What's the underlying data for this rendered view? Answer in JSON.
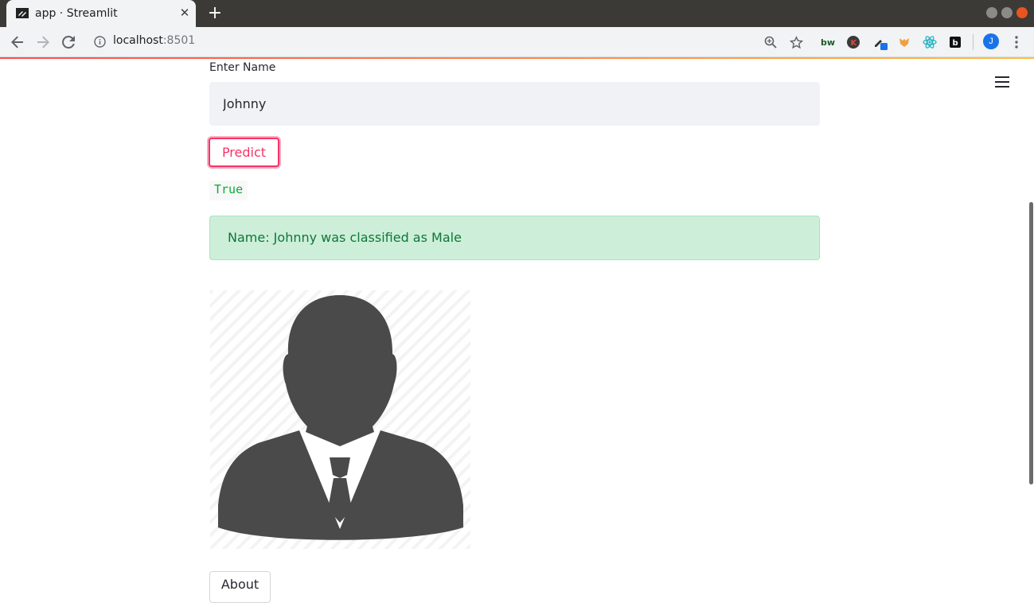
{
  "browser": {
    "tab_title": "app · Streamlit",
    "url_host": "localhost",
    "url_port": ":8501",
    "profile_initial": "J"
  },
  "form": {
    "label": "Enter Name",
    "value": "Johnny",
    "predict_label": "Predict"
  },
  "result": {
    "code_value": "True",
    "message": "Name: Johnny was classified as Male",
    "image_icon": "male-businessman-avatar-icon"
  },
  "footer": {
    "about_label": "About"
  },
  "colors": {
    "accent": "#f63366",
    "success_bg": "#cdefd9",
    "success_text": "#0f7637",
    "code_green": "#09ab3b"
  }
}
